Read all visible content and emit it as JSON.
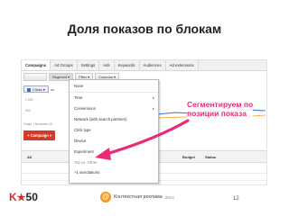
{
  "slide": {
    "title": "Доля показов по блокам",
    "page_number": "12"
  },
  "adwords": {
    "tabs": [
      "Campaigns",
      "Ad Groups",
      "Settings",
      "Ads",
      "Keywords",
      "Audiences",
      "Ad extensions"
    ],
    "active_tab": "Campaigns",
    "toolbar": {
      "segment": "Segment ▾",
      "filter": "Filter ▾",
      "columns": "Columns ▾"
    },
    "metric": {
      "selector": "Clicks ▾",
      "vs": "vs"
    },
    "chart": {
      "y_labels": [
        "1,000",
        "500"
      ],
      "caption": "Friday, 1 November 20"
    },
    "campaign_button": "+ Campaign ▾",
    "grid_headers": [
      "All",
      "Budget",
      "Status"
    ],
    "segment_menu": {
      "items": [
        {
          "label": "None",
          "muted": false,
          "submenu": false
        },
        {
          "label": "Time",
          "muted": false,
          "submenu": true
        },
        {
          "label": "Conversions",
          "muted": false,
          "submenu": true
        },
        {
          "label": "Network (with search partners)",
          "muted": false,
          "submenu": false
        },
        {
          "label": "Click type",
          "muted": false,
          "submenu": false
        },
        {
          "label": "Device",
          "muted": false,
          "submenu": false
        },
        {
          "label": "Experiment",
          "muted": false,
          "submenu": false
        },
        {
          "label": "Top vs. Other",
          "muted": true,
          "submenu": false
        },
        {
          "label": "+1 annotations",
          "muted": false,
          "submenu": false
        }
      ],
      "submenu_arrow": "▸"
    }
  },
  "annotation": {
    "line1": "Сегментируем по",
    "line2": "позиции показа",
    "color": "#ec2a7a"
  },
  "logos": {
    "k50": {
      "k": "K",
      "star": "★",
      "num": "50"
    },
    "brand": {
      "icon": "@",
      "name": "Контекстная реклама",
      "year": "2013"
    }
  }
}
